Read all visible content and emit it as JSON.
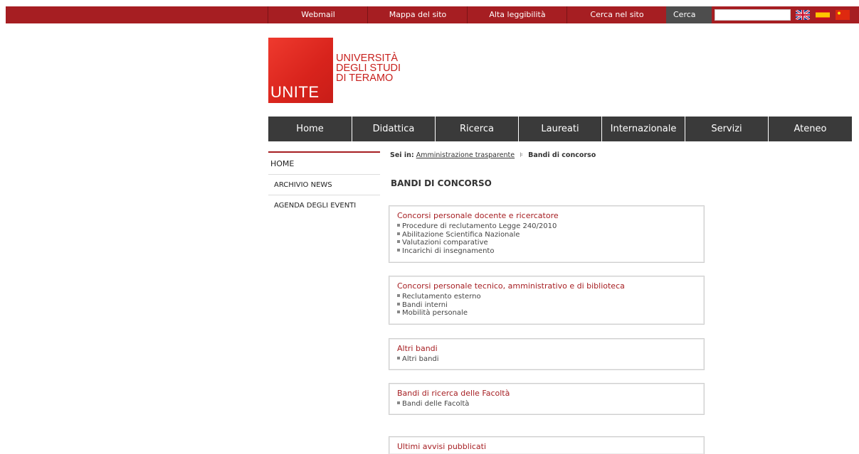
{
  "topbar": {
    "links": [
      "Webmail",
      "Mappa del sito",
      "Alta leggibilità",
      "Cerca nel sito"
    ],
    "search_label": "Cerca",
    "search_value": "",
    "flags": [
      "uk-flag-icon",
      "spain-flag-icon",
      "china-flag-icon"
    ]
  },
  "logo": {
    "mark": "UNITE",
    "line1": "UNIVERSITÀ",
    "line2": "DEGLI STUDI",
    "line3": "DI TERAMO"
  },
  "nav": {
    "items": [
      "Home",
      "Didattica",
      "Ricerca",
      "Laureati",
      "Internazionale",
      "Servizi",
      "Ateneo"
    ]
  },
  "sidebar": {
    "items": [
      "HOME",
      "ARCHIVIO NEWS",
      "AGENDA DEGLI EVENTI"
    ]
  },
  "breadcrumb": {
    "label": "Sei in:",
    "parent": "Amministrazione trasparente",
    "separator": "⊧",
    "current": "Bandi di concorso"
  },
  "page_title": "BANDI DI CONCORSO",
  "boxes": [
    {
      "title": "Concorsi personale docente e ricercatore",
      "items": [
        "Procedure di reclutamento Legge 240/2010",
        "Abilitazione Scientifica Nazionale",
        "Valutazioni comparative",
        "Incarichi di insegnamento"
      ]
    },
    {
      "title": "Concorsi personale tecnico, amministrativo e di biblioteca",
      "items": [
        "Reclutamento esterno",
        "Bandi interni",
        "Mobilità personale"
      ]
    },
    {
      "title": "Altri bandi",
      "items": [
        "Altri bandi"
      ]
    },
    {
      "title": "Bandi di ricerca delle Facoltà",
      "items": [
        "Bandi delle Facoltà"
      ]
    },
    {
      "title": "Ultimi avvisi pubblicati",
      "items": []
    }
  ],
  "colors": {
    "brand_red": "#a61e22",
    "nav_dark": "#3a3a3a",
    "logo_red": "#e2291f"
  }
}
